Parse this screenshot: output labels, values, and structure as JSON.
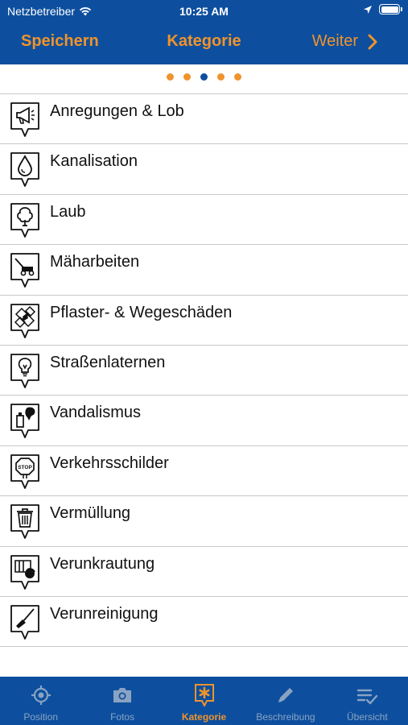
{
  "status": {
    "carrier": "Netzbetreiber",
    "time": "10:25 AM"
  },
  "nav": {
    "left": "Speichern",
    "title": "Kategorie",
    "right": "Weiter"
  },
  "progress": {
    "steps": 5,
    "current_step": 3
  },
  "categories": [
    {
      "label": "Anregungen & Lob",
      "icon": "megaphone-icon"
    },
    {
      "label": "Kanalisation",
      "icon": "water-drop-icon"
    },
    {
      "label": "Laub",
      "icon": "tree-icon"
    },
    {
      "label": "Mäharbeiten",
      "icon": "lawnmower-icon"
    },
    {
      "label": "Pflaster- & Wegeschäden",
      "icon": "paving-icon"
    },
    {
      "label": "Straßenlaternen",
      "icon": "lightbulb-icon"
    },
    {
      "label": "Vandalismus",
      "icon": "spray-can-icon"
    },
    {
      "label": "Verkehrsschilder",
      "icon": "stop-sign-icon"
    },
    {
      "label": "Vermüllung",
      "icon": "trash-can-icon"
    },
    {
      "label": "Verunkrautung",
      "icon": "weeds-icon"
    },
    {
      "label": "Verunreinigung",
      "icon": "broom-icon"
    }
  ],
  "stop_text": "STOP",
  "tabs": [
    {
      "label": "Position",
      "icon": "crosshair-icon"
    },
    {
      "label": "Fotos",
      "icon": "camera-icon"
    },
    {
      "label": "Kategorie",
      "icon": "asterisk-pin-icon",
      "active": true
    },
    {
      "label": "Beschreibung",
      "icon": "pencil-icon"
    },
    {
      "label": "Übersicht",
      "icon": "checklist-icon"
    }
  ],
  "colors": {
    "brand_blue": "#0d4f9e",
    "accent_orange": "#f0932b",
    "inactive_tab": "#8aa3c2"
  }
}
